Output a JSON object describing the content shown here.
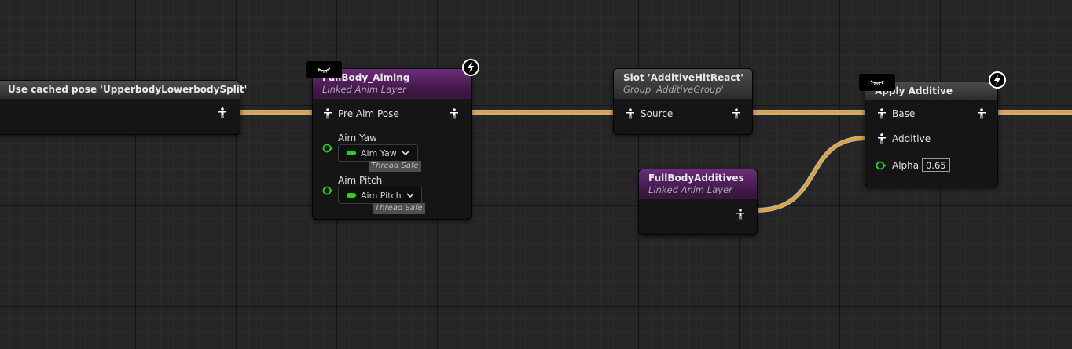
{
  "graph": {
    "nodes": {
      "cached_pose": {
        "title": "Use cached pose 'UpperbodyLowerbodySplit'"
      },
      "fullbody_aiming": {
        "title": "FullBody_Aiming",
        "subtitle": "Linked Anim Layer",
        "pins": {
          "pre_aim_pose": "Pre Aim Pose",
          "aim_yaw": "Aim Yaw",
          "aim_yaw_value": "Aim Yaw",
          "aim_pitch": "Aim Pitch",
          "aim_pitch_value": "Aim Pitch",
          "thread_safe": "Thread Safe"
        }
      },
      "slot": {
        "title": "Slot 'AdditiveHitReact'",
        "subtitle": "Group 'AdditiveGroup'",
        "pins": {
          "source": "Source"
        }
      },
      "fullbody_additives": {
        "title": "FullBodyAdditives",
        "subtitle": "Linked Anim Layer"
      },
      "apply_additive": {
        "title": "Apply Additive",
        "pins": {
          "base": "Base",
          "additive": "Additive",
          "alpha": "Alpha",
          "alpha_value": "0.65"
        }
      }
    },
    "colors": {
      "pose_wire": "#f0a020",
      "float_pin": "#28d017",
      "linked_layer_header": "#6c2c7a",
      "default_header": "#4d4d4d",
      "grid_background": "#262626"
    }
  }
}
